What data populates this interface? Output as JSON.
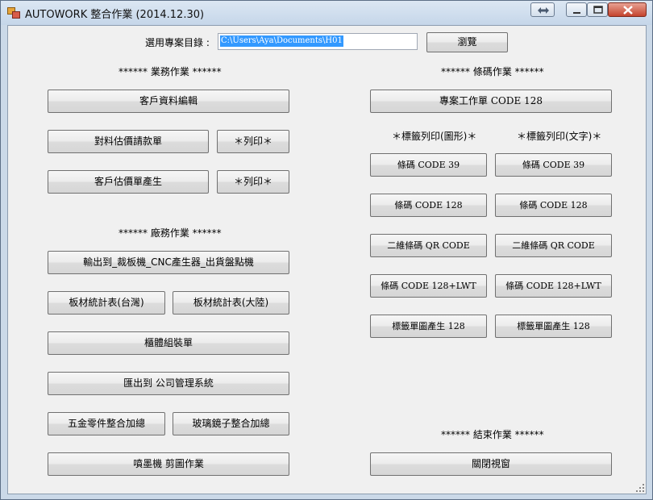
{
  "window": {
    "title": "AUTOWORK 整合作業 (2014.12.30)"
  },
  "project": {
    "label": "選用專案目錄 :",
    "path_value": "C:\\Users\\Aya\\Documents\\H01",
    "browse_label": "瀏覽"
  },
  "business": {
    "header": "****** 業務作業 ******",
    "customer_edit": "客戶資料編輯",
    "quote_request": "對料估價請款單",
    "print_1": "＊列印＊",
    "customer_quote": "客戶估價單產生",
    "print_2": "＊列印＊"
  },
  "factory": {
    "header": "****** 廠務作業 ******",
    "export_cnc": "輸出到_裁板機_CNC產生器_出貨盤點機",
    "board_stats_tw": "板材統計表(台灣)",
    "board_stats_cn": "板材統計表(大陸)",
    "cabinet_assembly": "櫃體組裝單",
    "export_company": "匯出到 公司管理系統",
    "hardware_merge": "五金零件整合加總",
    "glass_merge": "玻璃鏡子整合加總",
    "inkjet_cut": "噴墨機 剪圖作業"
  },
  "barcode": {
    "header": "****** 條碼作業 ******",
    "project_sheet": "專案工作單 CODE 128",
    "col_graphic": "＊標籤列印(圖形)＊",
    "col_text": "＊標籤列印(文字)＊",
    "rows": [
      {
        "graphic": "條碼 CODE  39",
        "text": "條碼 CODE  39"
      },
      {
        "graphic": "條碼 CODE 128",
        "text": "條碼 CODE 128"
      },
      {
        "graphic": "二維條碼 QR CODE",
        "text": "二維條碼 QR CODE"
      },
      {
        "graphic": "條碼 CODE 128+LWT",
        "text": "條碼 CODE 128+LWT"
      },
      {
        "graphic": "標籤單圖產生 128",
        "text": "標籤單圖產生 128"
      }
    ]
  },
  "end": {
    "header": "****** 結束作業 ******",
    "close_window": "關閉視窗"
  },
  "colors": {
    "window_frame": "#cbd9e8",
    "client_bg": "#f0f0f0",
    "selection": "#3399ff",
    "close_button": "#c4432d"
  }
}
